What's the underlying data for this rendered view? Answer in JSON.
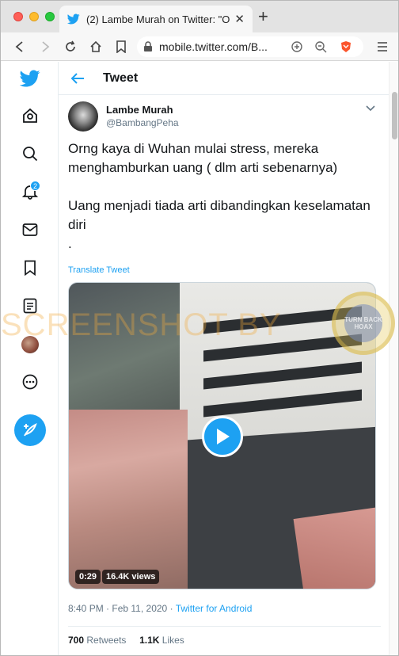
{
  "browser": {
    "tab_title": "(2) Lambe Murah on Twitter: \"Orng",
    "url": "mobile.twitter.com/B...",
    "colors": {
      "brave": "#fb542b"
    }
  },
  "sidebar": {
    "items": [
      "home-icon",
      "search-icon",
      "notifications-icon",
      "messages-icon",
      "bookmarks-icon",
      "lists-icon",
      "profile-avatar",
      "more-icon"
    ],
    "notification_count": "2",
    "compose_icon": "compose-tweet-icon"
  },
  "header": {
    "title": "Tweet"
  },
  "tweet": {
    "author_name": "Lambe Murah",
    "author_handle": "@BambangPeha",
    "text_line1": "Orng kaya di Wuhan mulai stress, mereka menghamburkan uang ( dlm arti sebenarnya)",
    "text_line2": "Uang menjadi tiada arti dibandingkan keselamatan diri",
    "text_line3": ".",
    "translate_label": "Translate Tweet",
    "video": {
      "duration": "0:29",
      "views": "16.4K views"
    },
    "time": "8:40 PM",
    "date": "Feb 11, 2020",
    "separator": "·",
    "source": "Twitter for Android",
    "retweets_count": "700",
    "retweets_label": "Retweets",
    "likes_count": "1.1K",
    "likes_label": "Likes"
  },
  "overlay": {
    "watermark": "SCREENSHOT BY",
    "seal_text": "TURN BACK HOAX"
  },
  "colors": {
    "accent": "#1da1f2",
    "text": "#14171a",
    "muted": "#657786"
  }
}
